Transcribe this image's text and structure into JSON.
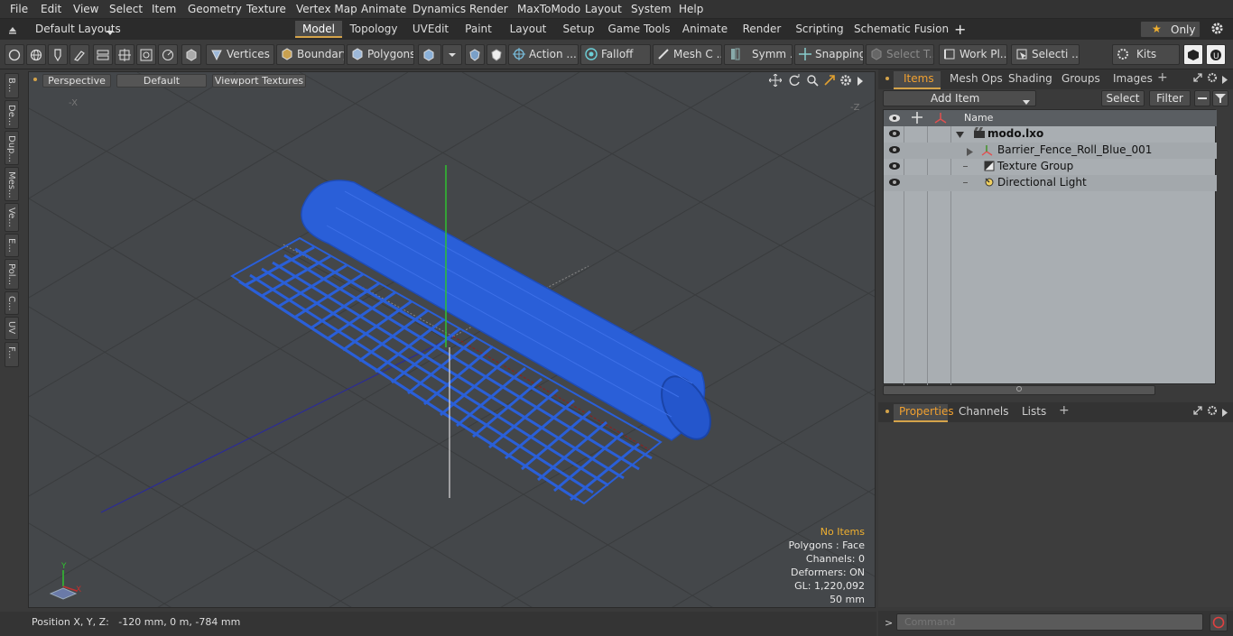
{
  "menu": [
    "File",
    "Edit",
    "View",
    "Select",
    "Item",
    "Geometry",
    "Texture",
    "Vertex Map",
    "Animate",
    "Dynamics",
    "Render",
    "MaxToModo",
    "Layout",
    "System",
    "Help"
  ],
  "layouts": {
    "dropdown": "Default Layouts",
    "tabs": [
      "Model",
      "Topology",
      "UVEdit",
      "Paint",
      "Layout",
      "Setup",
      "Game Tools",
      "Animate",
      "Render",
      "Scripting",
      "Schematic Fusion"
    ],
    "active_tab": "Model",
    "only_label": "Only"
  },
  "toolbar": {
    "vertices": "Vertices",
    "boundary": "Boundary",
    "polygons": "Polygons",
    "action": "Action ...",
    "falloff": "Falloff",
    "mesh": "Mesh C ...",
    "symm": "Symm ...",
    "snapping": "Snapping",
    "select_t": "Select T...",
    "work_plane": "Work Pl...",
    "selecti": "Selecti ...",
    "kits": "Kits"
  },
  "left_tabs": [
    "B...",
    "De...",
    "Dup...",
    "Mes...",
    "Ve...",
    "E...",
    "Pol...",
    "C...",
    "UV",
    "F..."
  ],
  "viewport": {
    "view_mode": "Perspective",
    "shading": "Default",
    "textures": "Viewport Textures",
    "axis_x_label": "-X",
    "axis_z_label": "-Z",
    "gizmo_y": "Y",
    "gizmo_x": "X",
    "stats": {
      "no_items": "No Items",
      "polygons": "Polygons : Face",
      "channels": "Channels: 0",
      "deformers": "Deformers: ON",
      "gl": "GL: 1,220,092",
      "scale": "50 mm"
    }
  },
  "status": {
    "position": "Position X, Y, Z:   -120 mm, 0 m, -784 mm"
  },
  "items_panel": {
    "tabs": [
      "Items",
      "Mesh Ops",
      "Shading",
      "Groups",
      "Images"
    ],
    "active_tab": "Items",
    "add_item": "Add Item",
    "select": "Select",
    "filter": "Filter",
    "name_header": "Name",
    "items": [
      {
        "name": "modo.lxo",
        "level": 0
      },
      {
        "name": "Barrier_Fence_Roll_Blue_001",
        "level": 1
      },
      {
        "name": "Texture Group",
        "level": 1
      },
      {
        "name": "Directional Light",
        "level": 1
      }
    ]
  },
  "properties_panel": {
    "tabs": [
      "Properties",
      "Channels",
      "Lists"
    ],
    "active_tab": "Properties"
  },
  "command": {
    "placeholder": "Command"
  },
  "colors": {
    "accent": "#d4a34a",
    "mesh_blue": "#2a5fd8",
    "active_tab_text": "#f0a030"
  }
}
